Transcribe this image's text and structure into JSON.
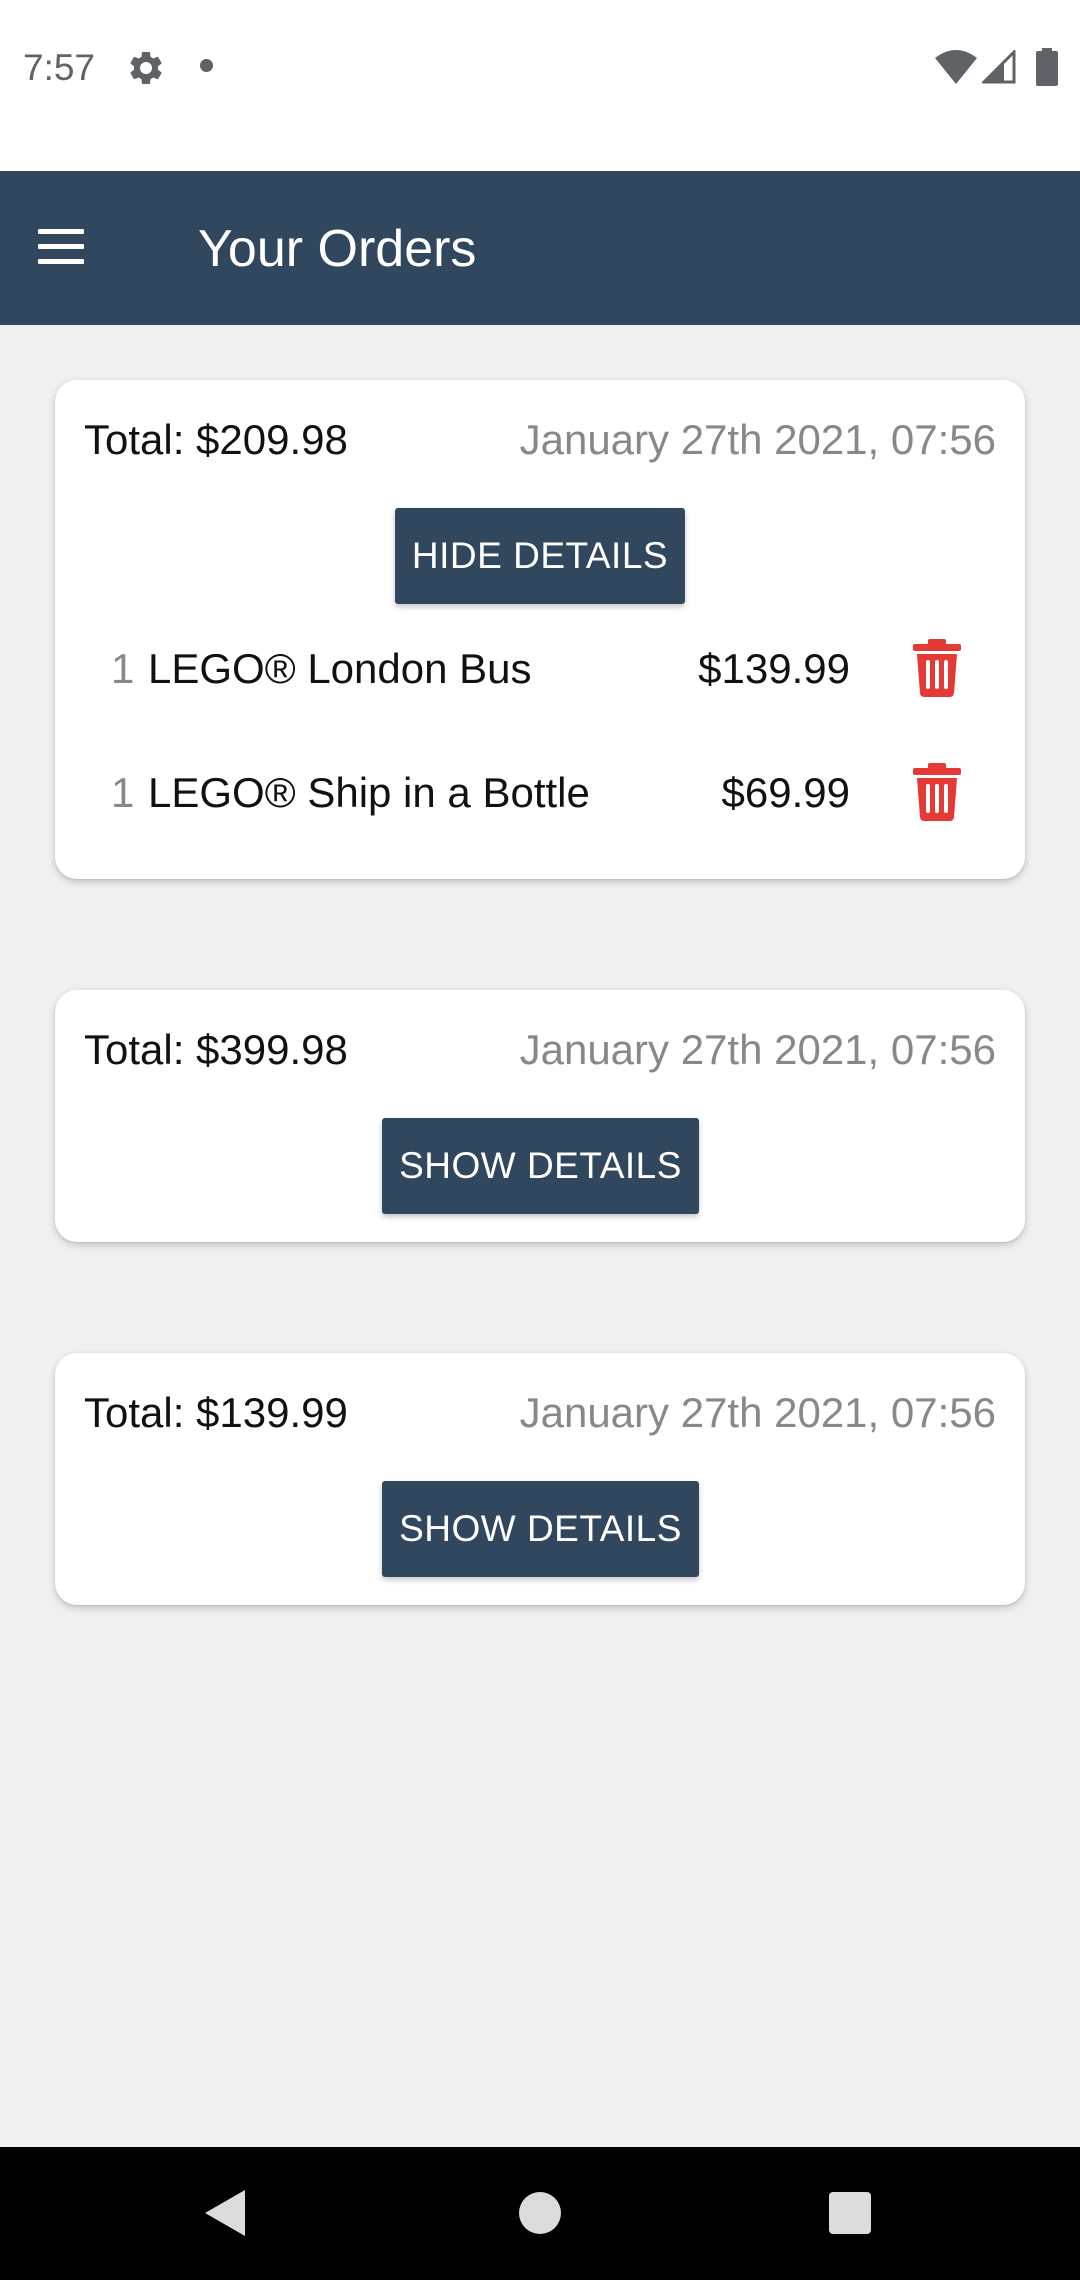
{
  "status_bar": {
    "time": "7:57",
    "icons": [
      "gear-icon",
      "notification-dot-icon",
      "wifi-icon",
      "signal-icon",
      "battery-icon"
    ]
  },
  "app_bar": {
    "title": "Your Orders",
    "menu_icon": "hamburger-menu-icon"
  },
  "colors": {
    "primary": "#31475e",
    "background": "#f0f0f0",
    "delete": "#e53935",
    "muted_text": "#888888"
  },
  "orders": [
    {
      "total": "Total: $209.98",
      "date": "January 27th 2021, 07:56",
      "details_button": "HIDE DETAILS",
      "expanded": true,
      "items": [
        {
          "qty": "1",
          "name": "LEGO® London Bus",
          "price": "$139.99",
          "icon": "trash-icon"
        },
        {
          "qty": "1",
          "name": "LEGO® Ship in a Bottle",
          "price": "$69.99",
          "icon": "trash-icon"
        }
      ]
    },
    {
      "total": "Total: $399.98",
      "date": "January 27th 2021, 07:56",
      "details_button": "SHOW DETAILS",
      "expanded": false
    },
    {
      "total": "Total: $139.99",
      "date": "January 27th 2021, 07:56",
      "details_button": "SHOW DETAILS",
      "expanded": false
    }
  ],
  "nav_bar": {
    "icons": [
      "back-icon",
      "home-icon",
      "recents-icon"
    ]
  }
}
